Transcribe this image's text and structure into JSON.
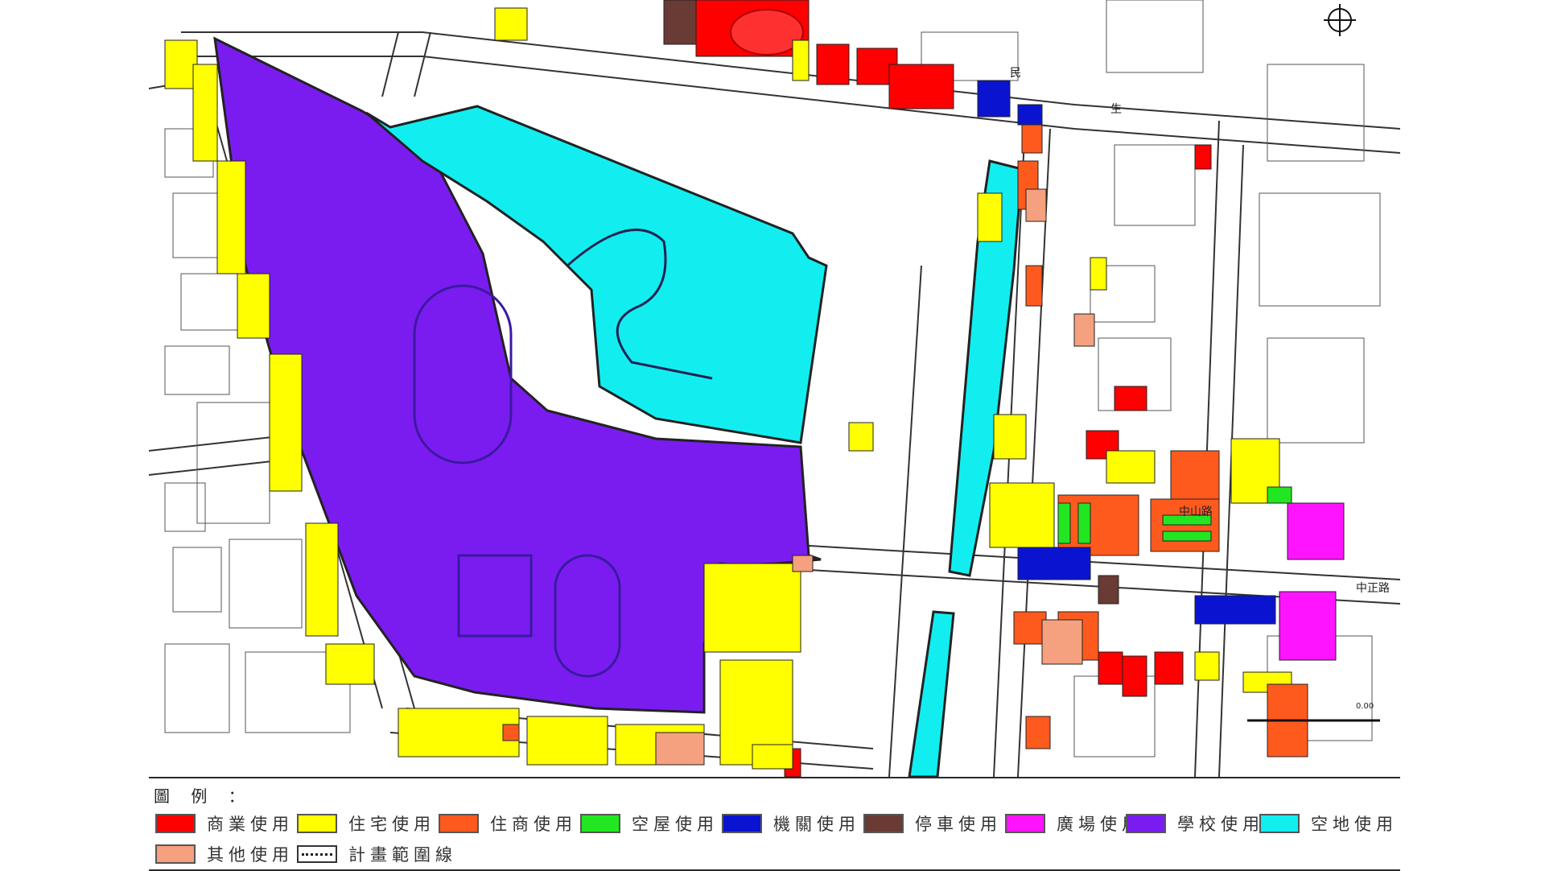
{
  "map": {
    "street_labels": [
      {
        "key": "min",
        "text": "民"
      },
      {
        "key": "sheng",
        "text": "生"
      },
      {
        "key": "zhongshan",
        "text": "中山路"
      },
      {
        "key": "zhongzheng",
        "text": "中正路"
      }
    ],
    "marker_label": "0.00"
  },
  "legend": {
    "title": "圖 例 ：",
    "items": [
      {
        "label": "商業使用",
        "color": "#ff0000"
      },
      {
        "label": "住宅使用",
        "color": "#ffff00"
      },
      {
        "label": "住商使用",
        "color": "#ff5a1e"
      },
      {
        "label": "空屋使用",
        "color": "#22e622"
      },
      {
        "label": "機關使用",
        "color": "#0a14d0"
      },
      {
        "label": "停車使用",
        "color": "#6a3a34"
      },
      {
        "label": "廣場使用",
        "color": "#ff14ff"
      },
      {
        "label": "學校使用",
        "color": "#7a1cf0"
      },
      {
        "label": "空地使用",
        "color": "#12eef0"
      },
      {
        "label": "其他使用",
        "color": "#f5a07e"
      }
    ],
    "boundary_label": "計畫範圍線"
  }
}
